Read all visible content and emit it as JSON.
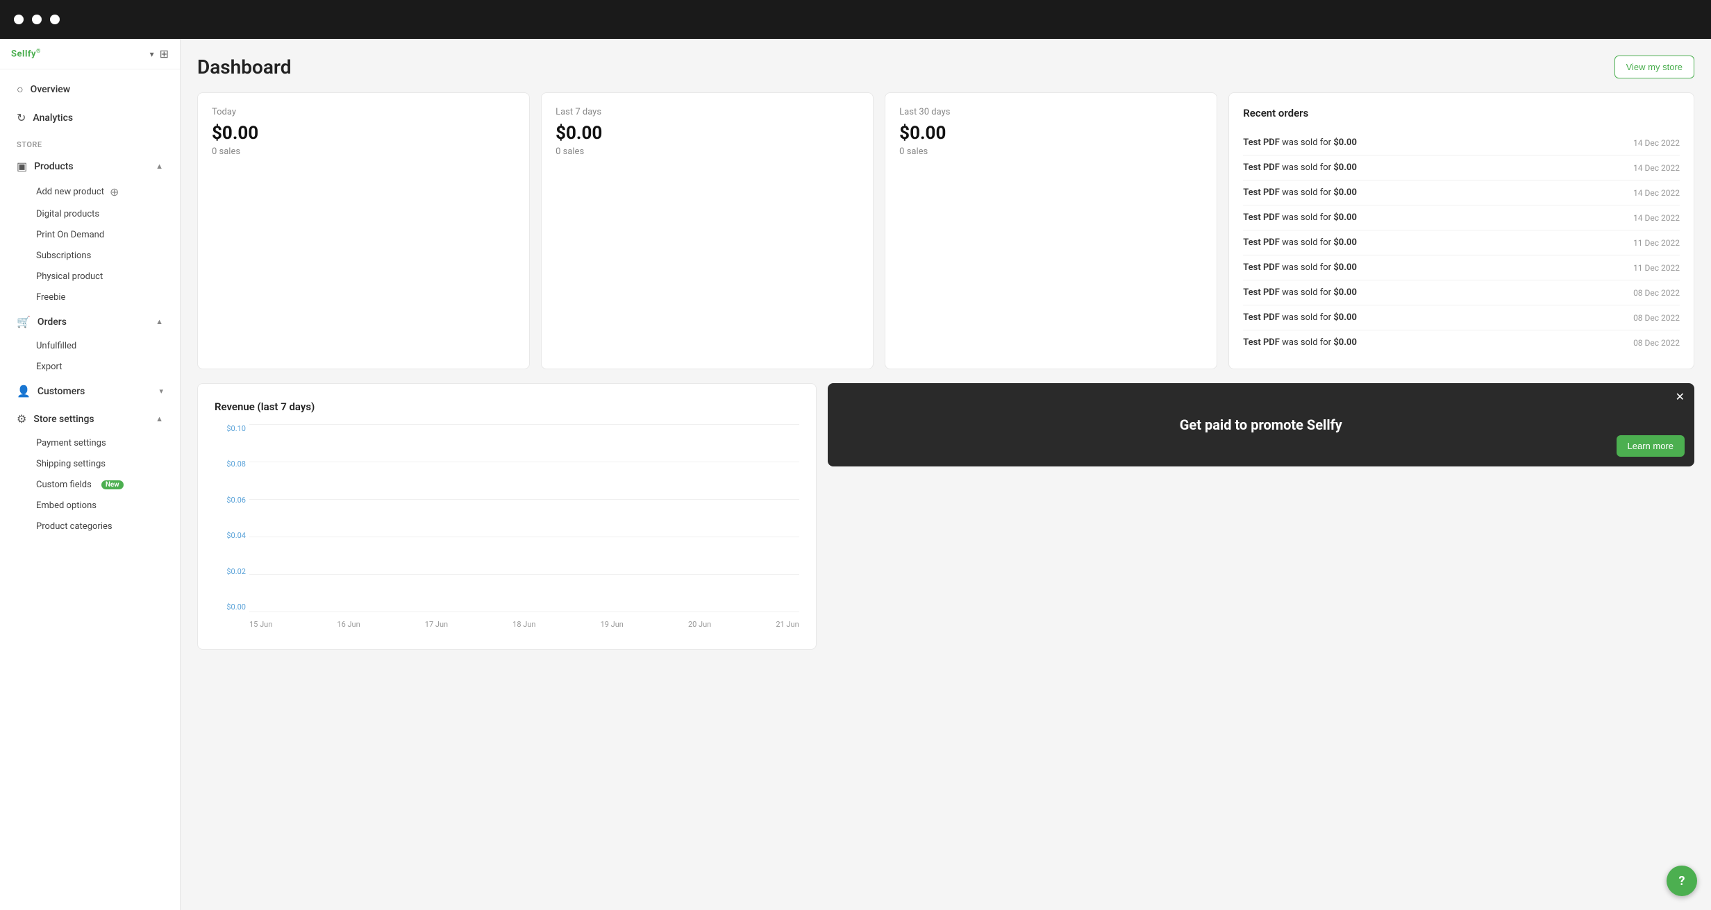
{
  "topbar": {
    "dots": [
      "dot1",
      "dot2",
      "dot3"
    ]
  },
  "sidebar": {
    "logo": "Sellfy",
    "logo_sup": "®",
    "store_label": "Store",
    "nav_items": [
      {
        "id": "overview",
        "label": "Overview",
        "icon": "○",
        "expandable": false
      },
      {
        "id": "analytics",
        "label": "Analytics",
        "icon": "↻",
        "expandable": false
      }
    ],
    "products": {
      "label": "Products",
      "icon": "▣",
      "expanded": true,
      "sub_items": [
        {
          "id": "add-new-product",
          "label": "Add new product",
          "has_icon": true
        },
        {
          "id": "digital-products",
          "label": "Digital products"
        },
        {
          "id": "print-on-demand",
          "label": "Print On Demand"
        },
        {
          "id": "subscriptions",
          "label": "Subscriptions"
        },
        {
          "id": "physical-product",
          "label": "Physical product"
        },
        {
          "id": "freebie",
          "label": "Freebie"
        }
      ]
    },
    "orders": {
      "label": "Orders",
      "icon": "🛒",
      "expanded": true,
      "sub_items": [
        {
          "id": "unfulfilled",
          "label": "Unfulfilled"
        },
        {
          "id": "export",
          "label": "Export"
        }
      ]
    },
    "customers": {
      "label": "Customers",
      "icon": "👤",
      "expanded": false
    },
    "store_settings": {
      "label": "Store settings",
      "icon": "⚙",
      "expanded": true,
      "sub_items": [
        {
          "id": "payment-settings",
          "label": "Payment settings"
        },
        {
          "id": "shipping-settings",
          "label": "Shipping settings"
        },
        {
          "id": "custom-fields",
          "label": "Custom fields",
          "badge": "New"
        },
        {
          "id": "embed-options",
          "label": "Embed options"
        },
        {
          "id": "product-categories",
          "label": "Product categories"
        }
      ]
    }
  },
  "main": {
    "page_title": "Dashboard",
    "view_store_btn": "View my store",
    "stats": [
      {
        "label": "Today",
        "value": "$0.00",
        "sub": "0 sales"
      },
      {
        "label": "Last 7 days",
        "value": "$0.00",
        "sub": "0 sales"
      },
      {
        "label": "Last 30 days",
        "value": "$0.00",
        "sub": "0 sales"
      }
    ],
    "recent_orders": {
      "title": "Recent orders",
      "orders": [
        {
          "product": "Test PDF",
          "sold_for": "$0.00",
          "date": "14 Dec 2022"
        },
        {
          "product": "Test PDF",
          "sold_for": "$0.00",
          "date": "14 Dec 2022"
        },
        {
          "product": "Test PDF",
          "sold_for": "$0.00",
          "date": "14 Dec 2022"
        },
        {
          "product": "Test PDF",
          "sold_for": "$0.00",
          "date": "14 Dec 2022"
        },
        {
          "product": "Test PDF",
          "sold_for": "$0.00",
          "date": "11 Dec 2022"
        },
        {
          "product": "Test PDF",
          "sold_for": "$0.00",
          "date": "11 Dec 2022"
        },
        {
          "product": "Test PDF",
          "sold_for": "$0.00",
          "date": "08 Dec 2022"
        },
        {
          "product": "Test PDF",
          "sold_for": "$0.00",
          "date": "08 Dec 2022"
        },
        {
          "product": "Test PDF",
          "sold_for": "$0.00",
          "date": "08 Dec 2022"
        }
      ],
      "sold_for_text": "was sold for"
    },
    "chart": {
      "title": "Revenue (last 7 days)",
      "y_labels": [
        "$0.10",
        "$0.08",
        "$0.06",
        "$0.04",
        "$0.02",
        "$0.00"
      ],
      "x_labels": [
        "15 Jun",
        "16 Jun",
        "17 Jun",
        "18 Jun",
        "19 Jun",
        "20 Jun",
        "21 Jun"
      ]
    },
    "promo": {
      "text": "Get paid to promote Sellfy"
    },
    "help_btn": "?"
  }
}
